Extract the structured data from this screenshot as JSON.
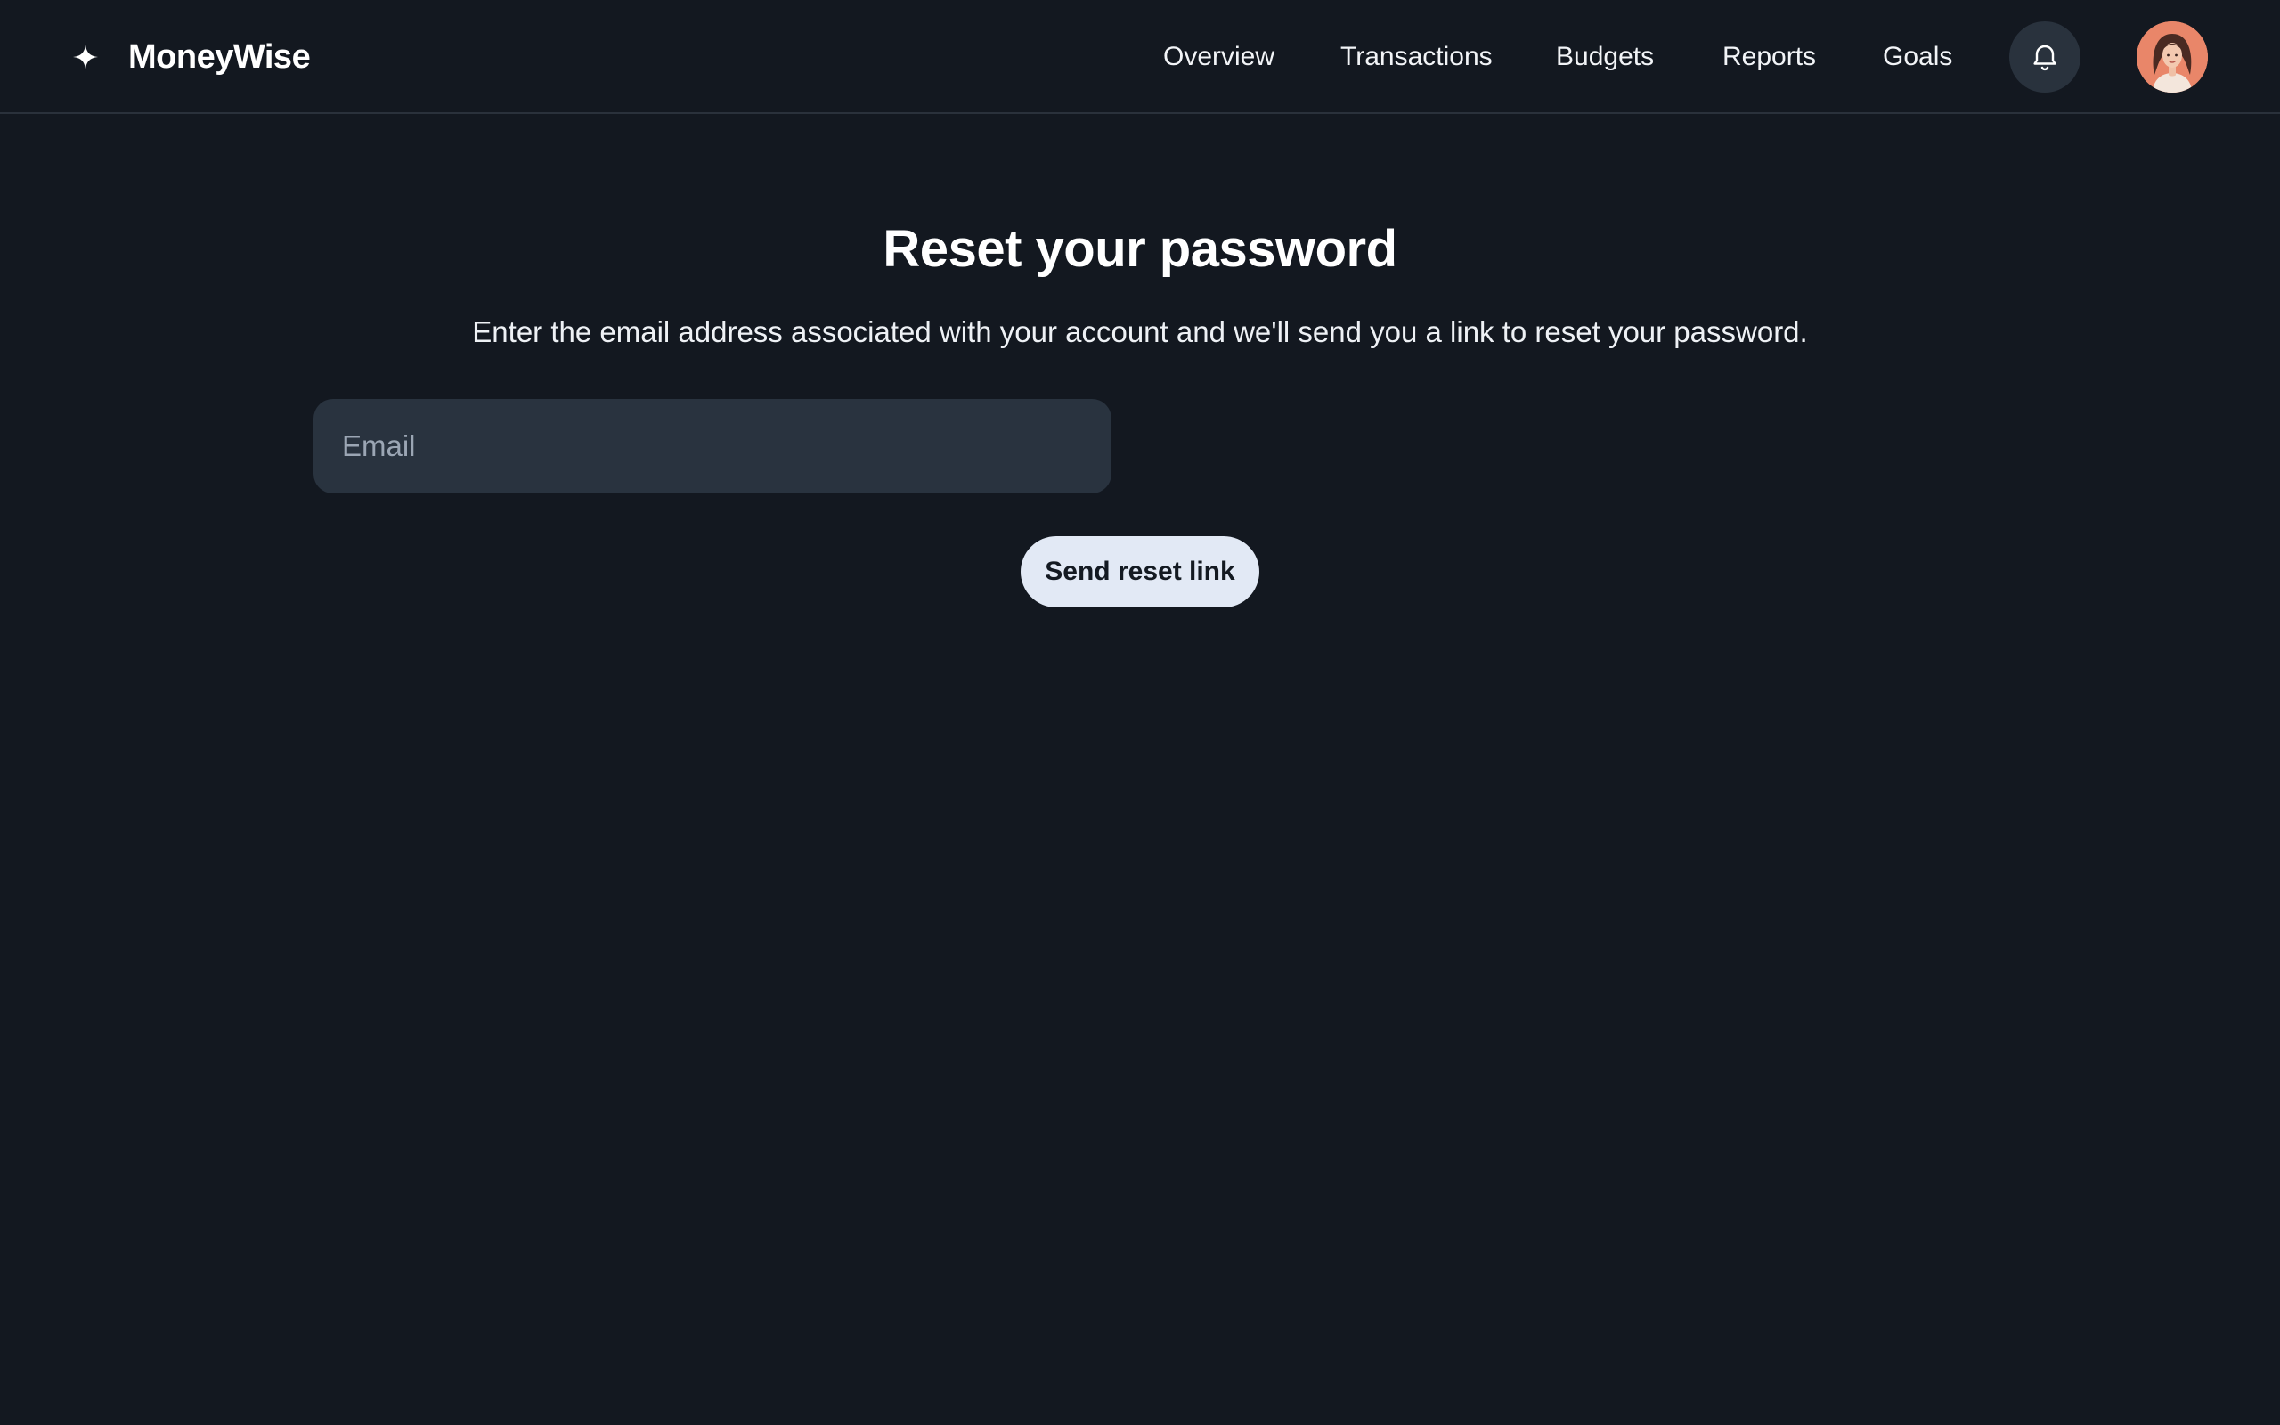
{
  "header": {
    "brand_icon": "sparkle-icon",
    "brand_name": "MoneyWise",
    "nav": [
      "Overview",
      "Transactions",
      "Budgets",
      "Reports",
      "Goals"
    ],
    "notifications_icon": "bell-icon",
    "avatar_icon": "user-avatar"
  },
  "main": {
    "title": "Reset your password",
    "description": "Enter the email address associated with your account and we'll send you a link to reset your password.",
    "email_placeholder": "Email",
    "email_value": "",
    "submit_label": "Send reset link"
  },
  "colors": {
    "background": "#131820",
    "input_background": "#29333f",
    "button_background": "#e2e9f5",
    "avatar_background": "#e98669"
  }
}
